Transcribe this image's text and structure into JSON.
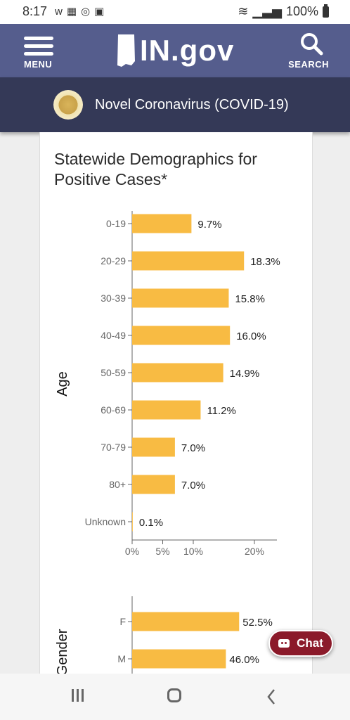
{
  "status_bar": {
    "time": "8:17",
    "battery": "100%",
    "left_icons": [
      "w-app-icon",
      "news-icon",
      "instagram-icon",
      "gallery-icon"
    ],
    "right_icons": [
      "wifi-icon",
      "signal-icon",
      "battery-icon"
    ]
  },
  "header": {
    "menu_label": "MENU",
    "logo_text": "IN.gov",
    "search_label": "SEARCH",
    "background": "#555d8d"
  },
  "sub_header": {
    "title": "Novel Coronavirus (COVID-19)",
    "background": "#343957"
  },
  "card": {
    "title_line1": "Statewide Demographics for",
    "title_line2": "Positive Cases*"
  },
  "chart_data": [
    {
      "type": "bar",
      "orientation": "horizontal",
      "ylabel": "Age",
      "categories": [
        "0-19",
        "20-29",
        "30-39",
        "40-49",
        "50-59",
        "60-69",
        "70-79",
        "80+",
        "Unknown"
      ],
      "values": [
        9.7,
        18.3,
        15.8,
        16.0,
        14.9,
        11.2,
        7.0,
        7.0,
        0.1
      ],
      "value_labels": [
        "9.7%",
        "18.3%",
        "15.8%",
        "16.0%",
        "14.9%",
        "11.2%",
        "7.0%",
        "7.0%",
        "0.1%"
      ],
      "xlim": [
        0,
        23.5
      ],
      "xticks": [
        0,
        5,
        10,
        20
      ],
      "xtick_labels": [
        "0%",
        "5%",
        "10%",
        "20%"
      ],
      "bar_color": "#f8bb43",
      "grid": false
    },
    {
      "type": "bar",
      "orientation": "horizontal",
      "ylabel": "Gender",
      "categories": [
        "F",
        "M"
      ],
      "values": [
        52.5,
        46.0
      ],
      "value_labels": [
        "52.5%",
        "46.0%"
      ],
      "bar_color": "#f8bb43",
      "grid": false
    }
  ],
  "chat_button": {
    "label": "Chat",
    "background": "#8b1a2a"
  }
}
